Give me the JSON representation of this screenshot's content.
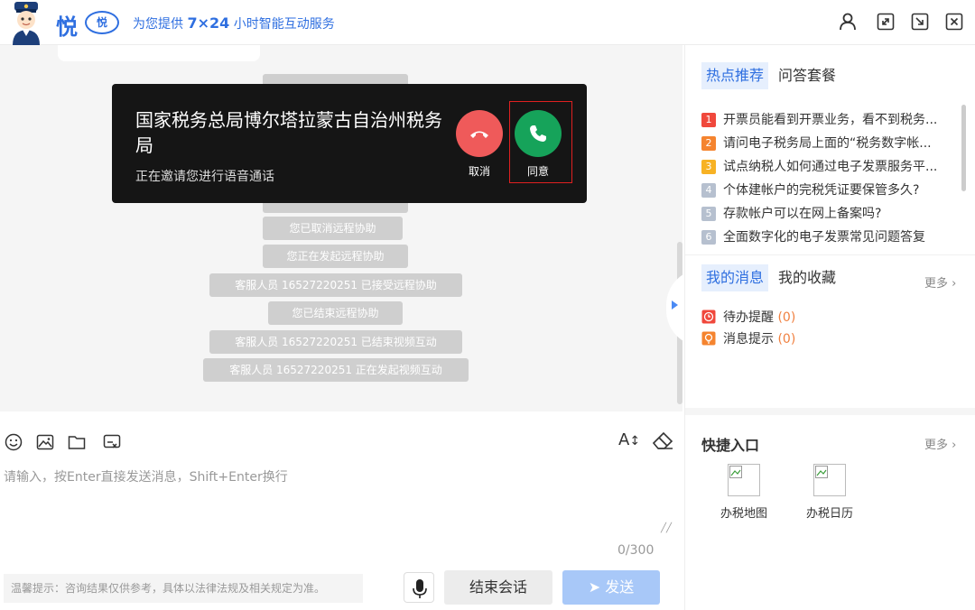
{
  "header": {
    "logo_text": "悦",
    "logo_badge": "悦",
    "slogan_pre": "为您提供 ",
    "slogan_bold": "7×24",
    "slogan_post": " 小时智能互动服务",
    "icons": [
      "user-icon",
      "expand-icon",
      "minimize-icon",
      "close-icon"
    ]
  },
  "chat": {
    "system_messages": [
      "您已取消远程协助",
      "您正在发起远程协助",
      "客服人员 16527220251 已接受远程协助",
      "您已结束远程协助",
      "客服人员 16527220251 已结束视频互动",
      "客服人员 16527220251 正在发起视频互动"
    ]
  },
  "call_popup": {
    "caller": "国家税务总局博尔塔拉蒙古自治州税务局",
    "subtitle": "正在邀请您进行语音通话",
    "cancel_label": "取消",
    "agree_label": "同意",
    "cancel_color": "#ef5a5a",
    "agree_color": "#16a35a"
  },
  "toolbar": {
    "icons": [
      "emoji-icon",
      "image-icon",
      "folder-icon",
      "screenshot-icon"
    ],
    "font_size_label": "A",
    "eraser_icon": "eraser-icon"
  },
  "input": {
    "placeholder": "请输入，按Enter直接发送消息，Shift+Enter换行",
    "value": "",
    "counter": "0/300"
  },
  "bottom": {
    "tip": "温馨提示：咨询结果仅供参考，具体以法律法规及相关规定为准。",
    "end_label": "结束会话",
    "send_label": "发送"
  },
  "right_panel": {
    "tabs_top": [
      "热点推荐",
      "问答套餐"
    ],
    "hot_items": [
      {
        "num": "1",
        "color": "#f0483c",
        "text": "开票员能看到开票业务，看不到税务..."
      },
      {
        "num": "2",
        "color": "#f5842f",
        "text": "请问电子税务局上面的“税务数字帐..."
      },
      {
        "num": "3",
        "color": "#f7b224",
        "text": "试点纳税人如何通过电子发票服务平..."
      },
      {
        "num": "4",
        "color": "#b6c0cf",
        "text": "个体建帐户的完税凭证要保管多久?"
      },
      {
        "num": "5",
        "color": "#b6c0cf",
        "text": "存款帐户可以在网上备案吗?"
      },
      {
        "num": "6",
        "color": "#b6c0cf",
        "text": "全面数字化的电子发票常见问题答复"
      }
    ],
    "tabs_msg": [
      "我的消息",
      "我的收藏"
    ],
    "more_label": "更多",
    "messages": [
      {
        "label": "待办提醒",
        "count": "(0)"
      },
      {
        "label": "消息提示",
        "count": "(0)"
      }
    ],
    "quick_title": "快捷入口",
    "quick_items": [
      "办税地图",
      "办税日历"
    ]
  }
}
